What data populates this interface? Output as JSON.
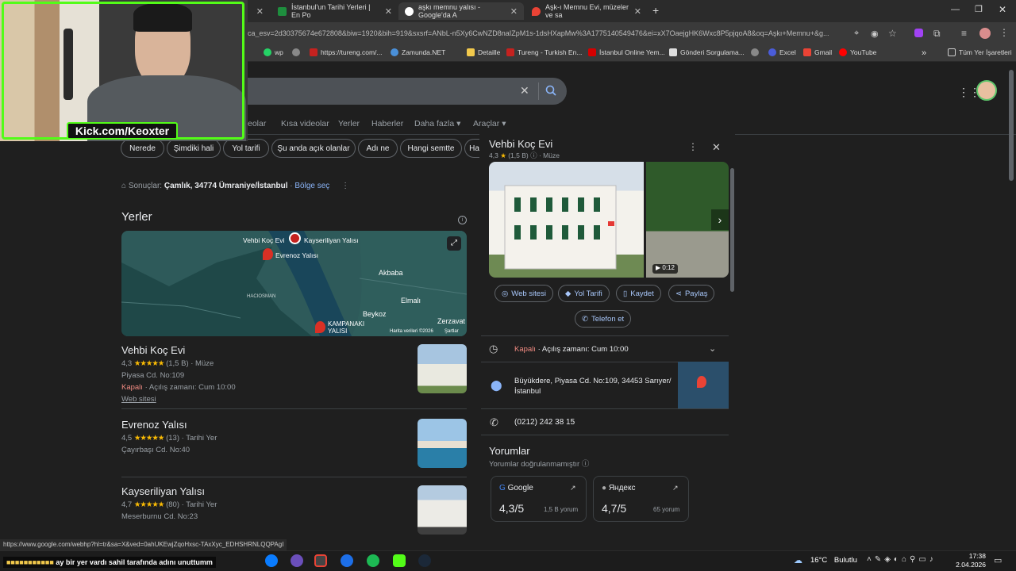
{
  "tabs": [
    {
      "label": "İstanbul'un Tarihi Yerleri | En Po",
      "active": false
    },
    {
      "label": "aşkı memnu yalısı - Google'da A",
      "active": true
    },
    {
      "label": "Aşk-ı Memnu Evi, müzeler ve sa",
      "active": false
    }
  ],
  "url": "ca_esv=2d30375674e672808&biw=1920&bih=919&sxsrf=ANbL-n5Xy6CwNZD8naIZpM1s-1dsHXapMw%3A1775140549476&ei=xX7OaejgHK6Wxc8P5pjqoA8&oq=Aşkı+Memnu+&g...",
  "bookmarks": [
    "wp",
    "https://tureng.com/...",
    "Zamunda.NET",
    "Detaille",
    "Tureng - Turkish En...",
    "İstanbul Online Yem...",
    "Gönderi Sorgulama...",
    "Excel",
    "Gmail",
    "YouTube"
  ],
  "all_bookmarks": "Tüm Yer İşaretleri",
  "streamer_tag": "Kick.com/Keoxter",
  "nav": [
    "eolar",
    "Kısa videolar",
    "Yerler",
    "Haberler",
    "Daha fazla",
    "Araçlar"
  ],
  "chips": [
    "Nerede",
    "Şimdiki hali",
    "Yol tarifi",
    "Şu anda açık olanlar",
    "Adı ne",
    "Hangi semtte",
    "Ha"
  ],
  "location": {
    "prefix": "Sonuçlar:",
    "place": "Çamlık, 34774 Ümraniye/İstanbul",
    "action": "Bölge seç"
  },
  "places_heading": "Yerler",
  "map": {
    "labels": [
      "Vehbi Koç Evi",
      "Kayseriliyan Yalısı",
      "Evrenoz Yalısı",
      "Akbaba",
      "HACIOSMAN",
      "Elmalı",
      "Beykoz",
      "Zerzavat",
      "KAMPANAKI",
      "YALISI"
    ],
    "credit": "Harita verileri ©2026",
    "terms": "Şartlar"
  },
  "results": [
    {
      "title": "Vehbi Koç Evi",
      "rating": "4,3",
      "stars": "★★★★★",
      "count": "(1,5 B)",
      "type": "· Müze",
      "address": "Piyasa Cd. No:109",
      "status": "Kapalı",
      "hours": "· Açılış zamanı: Cum 10:00",
      "link": "Web sitesi"
    },
    {
      "title": "Evrenoz Yalısı",
      "rating": "4,5",
      "stars": "★★★★★",
      "count": "(13)",
      "type": "· Tarihi Yer",
      "address": "Çayırbaşı Cd. No:40"
    },
    {
      "title": "Kayseriliyan Yalısı",
      "rating": "4,7",
      "stars": "★★★★★",
      "count": "(80)",
      "type": "· Tarihi Yer",
      "address": "Meserburnu Cd. No:23"
    }
  ],
  "panel": {
    "title": "Vehbi Koç Evi",
    "rating": "4,3",
    "star": "★",
    "count": "(1,5 B)",
    "type": "· Müze",
    "video": "0:12",
    "buttons": [
      "Web sitesi",
      "Yol Tarifi",
      "Kaydet",
      "Paylaş",
      "Telefon et"
    ],
    "status": "Kapalı",
    "hours": "· Açılış zamanı: Cum 10:00",
    "address_line1": "Büyükdere, Piyasa Cd. No:109, 34453 Sarıyer/",
    "address_line2": "İstanbul",
    "phone": "(0212) 242 38 15",
    "reviews_heading": "Yorumlar",
    "reviews_sub": "Yorumlar doğrulanmamıştır",
    "review_cards": [
      {
        "source": "Google",
        "score": "4,3/5",
        "count": "1,5 B yorum"
      },
      {
        "source": "Яндекс",
        "score": "4,7/5",
        "count": "65 yorum"
      }
    ]
  },
  "status_url": "https://www.google.com/webhp?hl=tr&sa=X&ved=0ahUKEwjZqoHxsc-TAxXyc_EDHSHRNLQQPAgI",
  "chat_message": "ay bir yer vardı sahil tarafında adını unuttumm",
  "weather": {
    "temp": "16°C",
    "desc": "Bulutlu"
  },
  "clock": {
    "time": "17:38",
    "date": "2.04.2026"
  }
}
